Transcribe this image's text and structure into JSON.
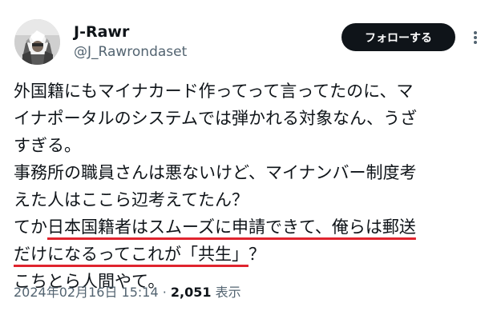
{
  "author": {
    "display_name": "J-Rawr",
    "handle": "@J_Rawrondaset",
    "avatar_icon": "profile-photo"
  },
  "follow_button": {
    "label": "フォローする"
  },
  "more_icon": "more-vertical-icon",
  "tweet": {
    "lines": [
      "外国籍にもマイナカード作ってって言ってたのに、マ",
      "イナポータルのシステムでは弾かれる対象なん、うざ",
      "すぎる。",
      "事務所の職員さんは悪ないけど、マイナンバー制度考",
      "えた人はここら辺考えてたん？"
    ],
    "line6_prefix": "てか",
    "line6_underlined": "日本国籍者はスムーズに申請できて、俺らは郵送",
    "line7_underlined": "だけになるってこれが「共生」",
    "line7_suffix": "？",
    "line8": "こちとら人間やて。"
  },
  "meta": {
    "timestamp": "2024年02月16日 15:14",
    "separator": " · ",
    "view_count": "2,051",
    "view_label": " 表示"
  },
  "colors": {
    "text": "#0f1419",
    "secondary": "#536471",
    "underline": "#e0242e",
    "button_bg": "#0f1419"
  }
}
